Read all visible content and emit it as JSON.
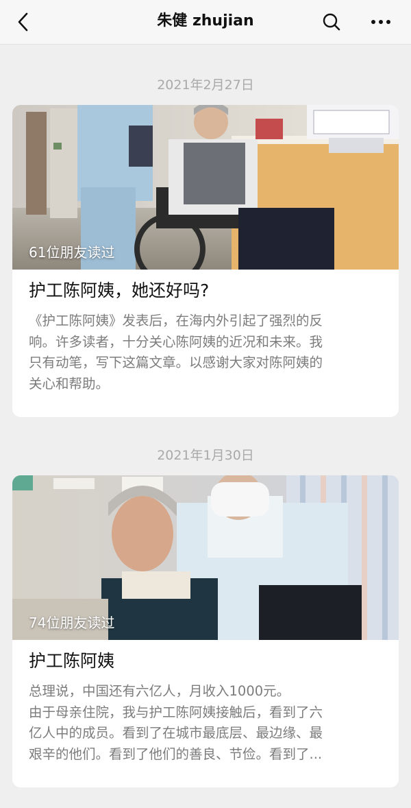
{
  "header": {
    "title": "朱健 zhujian",
    "back_icon": "chevron-left-icon",
    "search_icon": "search-icon",
    "more_icon": "more-horizontal-icon"
  },
  "articles": [
    {
      "date": "2021年2月27日",
      "read_count": "61位朋友读过",
      "title": "护工陈阿姨，她还好吗?",
      "summary_lines": [
        "《护工陈阿姨》发表后，在海内外引起了强烈的反",
        "响。许多读者，十分关心陈阿姨的近况和未来。我",
        "只有动笔，写下这篇文章。以感谢大家对陈阿姨的",
        "关心和帮助。"
      ]
    },
    {
      "date": "2021年1月30日",
      "read_count": "74位朋友读过",
      "title": "护工陈阿姨",
      "summary_lines": [
        "总理说，中国还有六亿人，月收入1000元。",
        "由于母亲住院，我与护工陈阿姨接触后，看到了六",
        "亿人中的成员。看到了在城市最底层、最边缘、最",
        "艰辛的他们。看到了他们的善良、节俭。看到了..."
      ]
    }
  ]
}
